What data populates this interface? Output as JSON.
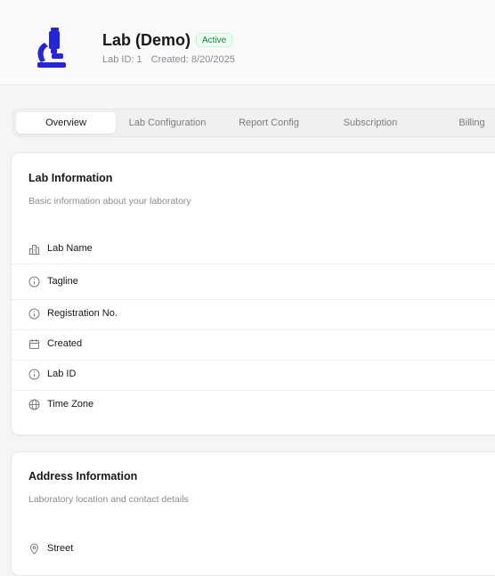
{
  "header": {
    "title": "Lab (Demo)",
    "status": "Active",
    "lab_id_text": "Lab ID: 1",
    "created_text": "Created: 8/20/2025",
    "logo_icon": "microscope-icon",
    "accent_color": "#2323e0"
  },
  "tabs": [
    {
      "label": "Overview",
      "active": true
    },
    {
      "label": "Lab Configuration",
      "active": false
    },
    {
      "label": "Report Config",
      "active": false
    },
    {
      "label": "Subscription",
      "active": false
    },
    {
      "label": "Billing",
      "active": false
    }
  ],
  "lab_info": {
    "title": "Lab Information",
    "subtitle": "Basic information about your laboratory",
    "fields": [
      {
        "label": "Lab Name",
        "icon": "building-icon"
      },
      {
        "label": "Tagline",
        "icon": "info-icon"
      },
      {
        "label": "Registration No.",
        "icon": "info-icon"
      },
      {
        "label": "Created",
        "icon": "calendar-icon"
      },
      {
        "label": "Lab ID",
        "icon": "info-icon"
      },
      {
        "label": "Time Zone",
        "icon": "globe-icon"
      }
    ]
  },
  "address_info": {
    "title": "Address Information",
    "subtitle": "Laboratory location and contact details",
    "fields": [
      {
        "label": "Street",
        "icon": "map-pin-icon"
      }
    ]
  }
}
